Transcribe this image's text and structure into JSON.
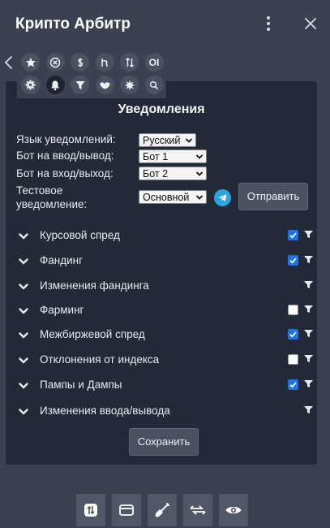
{
  "app": {
    "title": "Крипто Арбитр"
  },
  "toolbar": {
    "row1": [
      {
        "icon": "star-icon"
      },
      {
        "icon": "circle-x-icon"
      },
      {
        "icon": "dollar-icon"
      },
      {
        "icon": "fee-icon"
      },
      {
        "icon": "sort-arrows-icon"
      },
      {
        "icon": "oi-icon",
        "text": "OI"
      }
    ],
    "row2": [
      {
        "icon": "gear-icon"
      },
      {
        "icon": "bell-icon",
        "active": true
      },
      {
        "icon": "filter-icon"
      },
      {
        "icon": "handshake-icon"
      },
      {
        "icon": "burst-icon"
      },
      {
        "icon": "search-icon"
      }
    ]
  },
  "panel": {
    "title": "Уведомления",
    "fields": {
      "language_label": "Язык уведомлений:",
      "language_value": "Русский",
      "bot_io_label": "Бот на ввод/вывод:",
      "bot_io_value": "Бот 1",
      "bot_entry_label": "Бот на вход/выход:",
      "bot_entry_value": "Бот 2",
      "test_label_line1": "Тестовое",
      "test_label_line2": "уведомление:",
      "test_value": "Основной",
      "send_label": "Отправить"
    },
    "sections": [
      {
        "label": "Курсовой спред",
        "checkbox": true
      },
      {
        "label": "Фандинг",
        "checkbox": true
      },
      {
        "label": "Изменения фандинга",
        "checkbox": null
      },
      {
        "label": "Фарминг",
        "checkbox": false
      },
      {
        "label": "Межбиржевой спред",
        "checkbox": true
      },
      {
        "label": "Отклонения от индекса",
        "checkbox": false
      },
      {
        "label": "Пампы и Дампы",
        "checkbox": true
      },
      {
        "label": "Изменения ввода/вывода",
        "checkbox": null
      }
    ],
    "save_label": "Сохранить"
  },
  "bottom_bar": [
    "transfer-icon",
    "wallet-icon",
    "shovel-icon",
    "exchange-icon",
    "eye-icon"
  ],
  "colors": {
    "background": "#3a4150",
    "panel": "#222937",
    "button": "#4a5262",
    "checkbox_on": "#1a73e8",
    "telegram": "#2aa3e0"
  }
}
